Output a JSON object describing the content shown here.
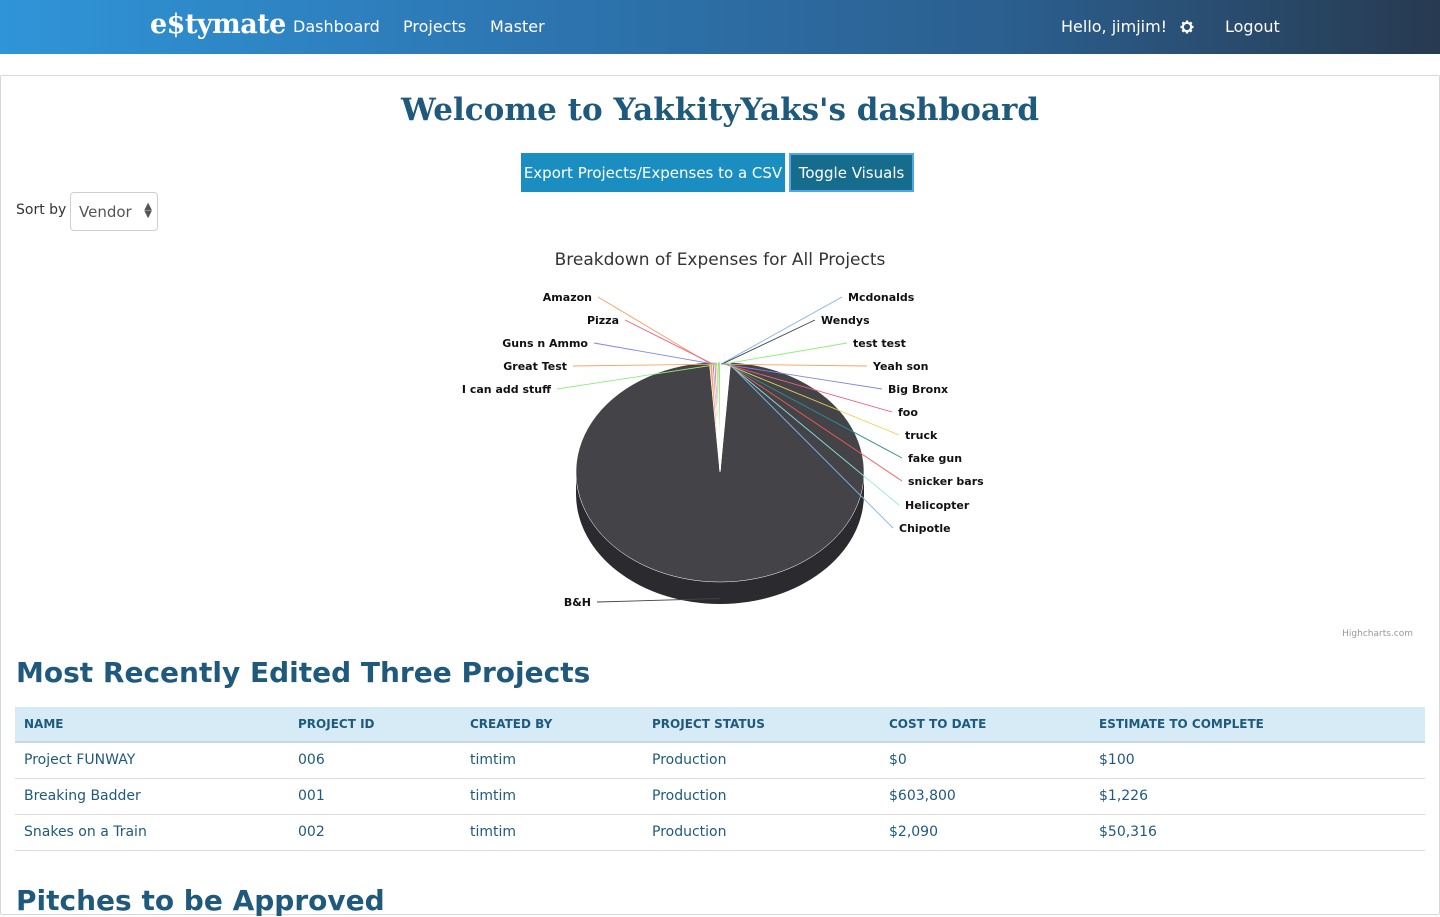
{
  "nav": {
    "brand": "e$tymate",
    "links": [
      "Dashboard",
      "Projects",
      "Master"
    ],
    "greeting": "Hello, jimjim!",
    "settings_icon": "gear-icon",
    "logout": "Logout"
  },
  "dashboard": {
    "title": "Welcome to YakkityYaks's dashboard",
    "export_button": "Export Projects/Expenses to a CSV",
    "toggle_button": "Toggle Visuals",
    "sort_label": "Sort by",
    "sort_value": "Vendor",
    "credit": "Highcharts.com"
  },
  "chart_data": {
    "type": "pie",
    "title": "Breakdown of Expenses for All Projects",
    "labels": [
      "B&H",
      "Amazon",
      "Pizza",
      "Guns n Ammo",
      "Great Test",
      "I can add stuff",
      "Mcdonalds",
      "Wendys",
      "test test",
      "Yeah son",
      "Big Bronx",
      "foo",
      "truck",
      "fake gun",
      "snicker bars",
      "Helicopter",
      "Chipotle"
    ],
    "values": [
      96.5,
      0.3,
      0.2,
      0.2,
      0.2,
      0.3,
      0.1,
      0.1,
      0.1,
      0.1,
      0.1,
      0.1,
      0.1,
      0.1,
      0.1,
      0.1,
      0.1
    ],
    "colors": [
      "#434348",
      "#f7a35c",
      "#f15c80",
      "#8085e9",
      "#f7a35c",
      "#90ed7d",
      "#7cb5ec",
      "#434348",
      "#90ed7d",
      "#f7a35c",
      "#8085e9",
      "#f15c80",
      "#e4d354",
      "#2b908f",
      "#f45b5b",
      "#91e8e1",
      "#7cb5ec"
    ],
    "highlight": "Big Bronx",
    "legend": "none"
  },
  "recent": {
    "title": "Most Recently Edited Three Projects",
    "columns": [
      "NAME",
      "PROJECT ID",
      "CREATED BY",
      "PROJECT STATUS",
      "COST TO DATE",
      "ESTIMATE TO COMPLETE"
    ],
    "rows": [
      [
        "Project FUNWAY",
        "006",
        "timtim",
        "Production",
        "$0",
        "$100"
      ],
      [
        "Breaking Badder",
        "001",
        "timtim",
        "Production",
        "$603,800",
        "$1,226"
      ],
      [
        "Snakes on a Train",
        "002",
        "timtim",
        "Production",
        "$2,090",
        "$50,316"
      ]
    ]
  },
  "pitches": {
    "title": "Pitches to be Approved"
  }
}
